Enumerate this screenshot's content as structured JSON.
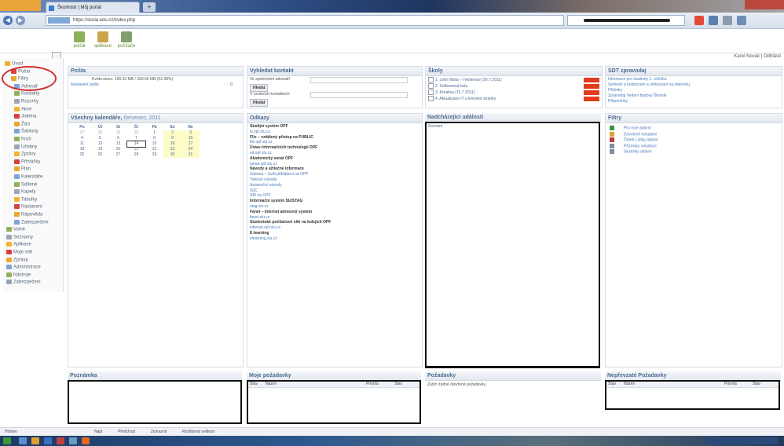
{
  "browser": {
    "tab_title": "Školmistr | Můj portál",
    "new_tab": "+",
    "url": "https://skola.edu.cz/index.php",
    "nav": {
      "back": "◀",
      "forward": "▶"
    }
  },
  "toolbar": {
    "buttons": [
      {
        "label": "portál",
        "color": "#8fb05a"
      },
      {
        "label": "aplikace",
        "color": "#c9a44a"
      },
      {
        "label": "počítače",
        "color": "#7fa06a"
      }
    ]
  },
  "user_info": "Karel Novák | Odhlásit",
  "sidebar": {
    "items": [
      {
        "label": "Úvod"
      },
      {
        "label": "Pošta"
      },
      {
        "label": "Filtry"
      },
      {
        "label": "Adresář"
      },
      {
        "label": "Kontakty"
      },
      {
        "label": "Rozvrhy"
      },
      {
        "label": "Akce"
      },
      {
        "label": "Jídelna"
      },
      {
        "label": "Žáci"
      },
      {
        "label": "Šablony"
      },
      {
        "label": "Kruh"
      },
      {
        "label": "Učebny"
      },
      {
        "label": "Zprávy"
      },
      {
        "label": "Přihlášky"
      },
      {
        "label": "Plán"
      },
      {
        "label": "Kalendáře"
      },
      {
        "label": "Sdílené"
      },
      {
        "label": "Kapely"
      },
      {
        "label": "Tabulky"
      },
      {
        "label": "Nastavení"
      },
      {
        "label": "Nápověda"
      },
      {
        "label": "Zabezpečení"
      },
      {
        "label": "Volné"
      },
      {
        "label": "Seznamy"
      },
      {
        "label": "Aplikace"
      },
      {
        "label": "Moje sítě"
      },
      {
        "label": "Zprávy"
      },
      {
        "label": "Administrace"
      },
      {
        "label": "Nástroje"
      },
      {
        "label": "Zabezpečení"
      }
    ]
  },
  "posta": {
    "title": "Pošta",
    "quota": "Kvóta stavu: 156,33 MB / 300,00 MB (52,08%)",
    "link": "Nastavení pošty",
    "count": "0"
  },
  "contacts": {
    "title": "Vyhledat kontakt",
    "label1": "Ve společném adresáři",
    "btn1": "Hledat",
    "label2": "V osobních kontaktech",
    "btn2": "Hledat"
  },
  "schools": {
    "title": "Školy",
    "items": [
      {
        "label": "1. Letní škola – Tendencie (26.7.2011)",
        "badge": "#e23c1c"
      },
      {
        "label": "2. Softwarová kola",
        "badge": "#e23c1c"
      },
      {
        "label": "3. Kreativa (15.7.2011)",
        "badge": "#e23c1c"
      },
      {
        "label": "4. Aktualizace IT a kreslení stránky",
        "badge": "#e23c1c"
      }
    ]
  },
  "sdt": {
    "title": "SDT zpravodaj",
    "items": [
      "Informace pro studenty 1. ročníku",
      "Semestr a hodnocení a omlouvání na internetu",
      "Příjímky",
      "Zpravodaj Vedení budovy Školník",
      "Připomínky"
    ]
  },
  "calendar": {
    "title": "Všechny kalendáře,",
    "month": "červenec, 2011",
    "days": [
      "Po",
      "Út",
      "St",
      "Čt",
      "Pá",
      "So",
      "Ne"
    ],
    "weeks": [
      [
        "27",
        "28",
        "29",
        "30",
        "1",
        "2",
        "3"
      ],
      [
        "4",
        "5",
        "6",
        "7",
        "8",
        "9",
        "10"
      ],
      [
        "11",
        "12",
        "13",
        "14",
        "15",
        "16",
        "17"
      ],
      [
        "18",
        "19",
        "20",
        "21",
        "22",
        "23",
        "24"
      ],
      [
        "25",
        "26",
        "27",
        "28",
        "29",
        "30",
        "31"
      ]
    ],
    "today": "14"
  },
  "links": {
    "title": "Odkazy",
    "items": [
      {
        "text": "Studijní systém OPF",
        "bold": true
      },
      {
        "text": "is.opf.slu.cz",
        "bold": false
      },
      {
        "text": "Flix – vzdálený přístup na PUBLIC",
        "bold": true
      },
      {
        "text": "flix.opf.slu.cz",
        "bold": false
      },
      {
        "text": "Ústav informačních technologií OPF",
        "bold": true
      },
      {
        "text": "uit.opf.slu.cz",
        "bold": false
      },
      {
        "text": "Akademický senát OPF",
        "bold": true
      },
      {
        "text": "senat.opf.slu.cz",
        "bold": false
      },
      {
        "text": "Návody a užitečné informace",
        "bold": true
      },
      {
        "text": "Zdarma – Svět přihlášení na OPF",
        "bold": false
      },
      {
        "text": "Tiskové návody",
        "bold": false
      },
      {
        "text": "Asistenční návody",
        "bold": false
      },
      {
        "text": "ISIC",
        "bold": false
      },
      {
        "text": "SBI na OPF",
        "bold": false
      },
      {
        "text": "Informační systém SU/STAG",
        "bold": true
      },
      {
        "text": "stag.slu.cz",
        "bold": false
      },
      {
        "text": "Fanet – Internet adresový systém",
        "bold": true
      },
      {
        "text": "fanet.slu.cz",
        "bold": false
      },
      {
        "text": "Studentské počítačové sítě na kolejích OPF",
        "bold": true
      },
      {
        "text": "internet.opf.slu.cz",
        "bold": false
      },
      {
        "text": "E-learning",
        "bold": true
      },
      {
        "text": "elearning.slu.cz",
        "bold": false
      }
    ]
  },
  "events": {
    "title": "Nadcházející události",
    "subtitle": "Seznam"
  },
  "filters": {
    "title": "Filtry",
    "items": [
      {
        "label": "Pro mne aktivní",
        "color": "#3f8f3f"
      },
      {
        "label": "Dovolené nekativní",
        "color": "#e0a030"
      },
      {
        "label": "Četné Lístky aktivní",
        "color": "#c03a3a"
      },
      {
        "label": "Přiznívky nekativní",
        "color": "#7a8fa5"
      },
      {
        "label": "Skartrtky aktivní",
        "color": "#7a8fa5"
      }
    ]
  },
  "bottom": {
    "poznamka": "Poznámka",
    "moje": {
      "title": "Moje požadavky",
      "cols": [
        "Stav",
        "Název",
        "Priorita",
        "Stav"
      ]
    },
    "pozadavky": {
      "title": "Požadavky",
      "text": "Zatím žádné otevřené požadavky."
    },
    "neprevzate": {
      "title": "Nepřevzaté Požadavky",
      "cols": [
        "Stav",
        "Název",
        "Priorita",
        "Stav"
      ]
    }
  },
  "statusbar": {
    "left": "Hotovo",
    "items": [
      "Najít",
      "Předchozí",
      "Zvýraznit",
      "Rozlišovat velikost"
    ]
  }
}
